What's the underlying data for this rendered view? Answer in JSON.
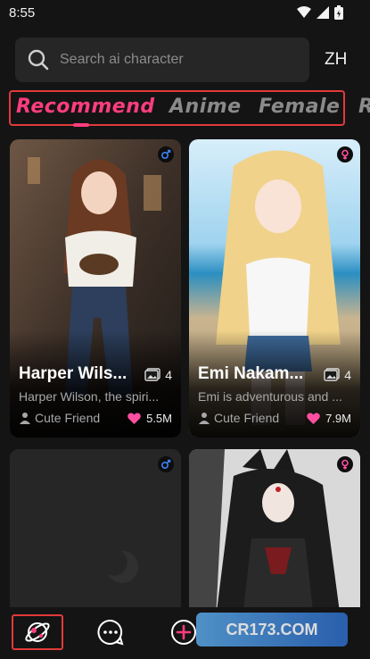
{
  "status": {
    "time": "8:55"
  },
  "search": {
    "placeholder": "Search ai character",
    "lang": "ZH"
  },
  "tabs": [
    {
      "label": "Recommend",
      "active": true
    },
    {
      "label": "Anime",
      "active": false
    },
    {
      "label": "Female",
      "active": false
    },
    {
      "label": "R",
      "active": false
    }
  ],
  "cards": [
    {
      "name": "Harper Wils...",
      "image_count": "4",
      "description": "Harper Wilson, the spiri...",
      "tag": "Cute Friend",
      "likes": "5.5M",
      "gender": "male"
    },
    {
      "name": "Emi Nakam...",
      "image_count": "4",
      "description": "Emi is adventurous and ...",
      "tag": "Cute Friend",
      "likes": "7.9M",
      "gender": "female"
    },
    {
      "gender": "male"
    },
    {
      "gender": "female"
    }
  ],
  "watermark": {
    "text": "CR173.COM"
  },
  "colors": {
    "accent": "#ff3d7f",
    "highlight": "#e23a3a",
    "male": "#3b82f6",
    "female": "#ff4fa1"
  }
}
